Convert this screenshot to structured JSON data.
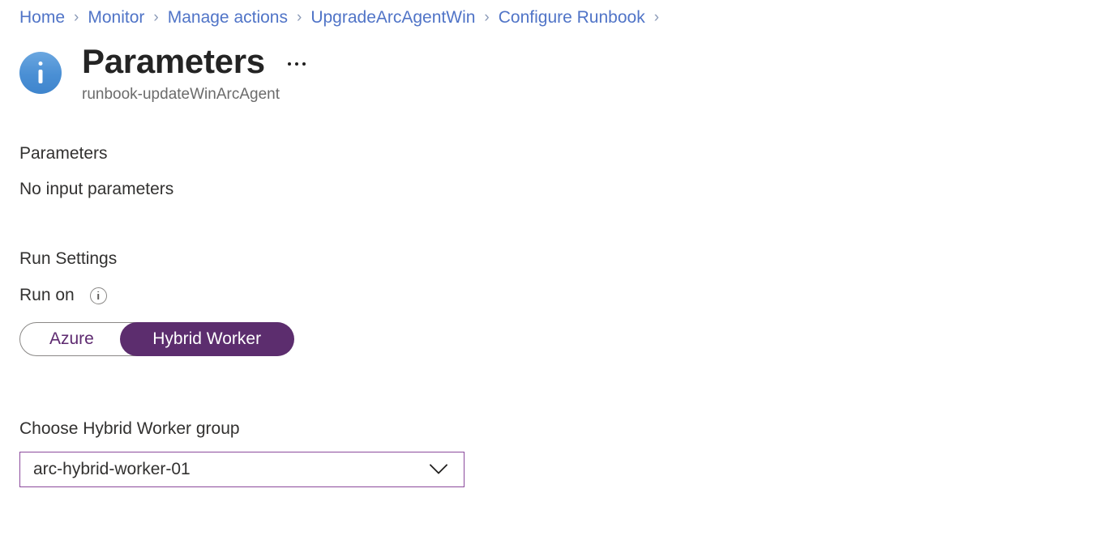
{
  "breadcrumb": {
    "separator": "›",
    "items": [
      {
        "label": "Home"
      },
      {
        "label": "Monitor"
      },
      {
        "label": "Manage actions"
      },
      {
        "label": "UpgradeArcAgentWin"
      },
      {
        "label": "Configure Runbook"
      }
    ],
    "trailing_separator": "›"
  },
  "header": {
    "icon": "info-circle-icon",
    "title": "Parameters",
    "subtitle": "runbook-updateWinArcAgent",
    "more_menu": "more-actions-ellipsis"
  },
  "main": {
    "parameters": {
      "heading": "Parameters",
      "empty_text": "No input parameters"
    },
    "run_settings": {
      "heading": "Run Settings",
      "run_on": {
        "label": "Run on",
        "info_icon": "info-outline-icon",
        "options": [
          {
            "label": "Azure",
            "selected": false
          },
          {
            "label": "Hybrid Worker",
            "selected": true
          }
        ]
      }
    },
    "hybrid_worker_group": {
      "label": "Choose Hybrid Worker group",
      "value": "arc-hybrid-worker-01",
      "chevron_icon": "chevron-down-icon"
    }
  },
  "colors": {
    "breadcrumb_link": "#5074c7",
    "accent_purple": "#5c2d6e",
    "dropdown_border": "#8b4a9c",
    "info_blue": "#4a8fd4",
    "text_primary": "#323130",
    "text_subtitle": "#6b6b6b"
  }
}
